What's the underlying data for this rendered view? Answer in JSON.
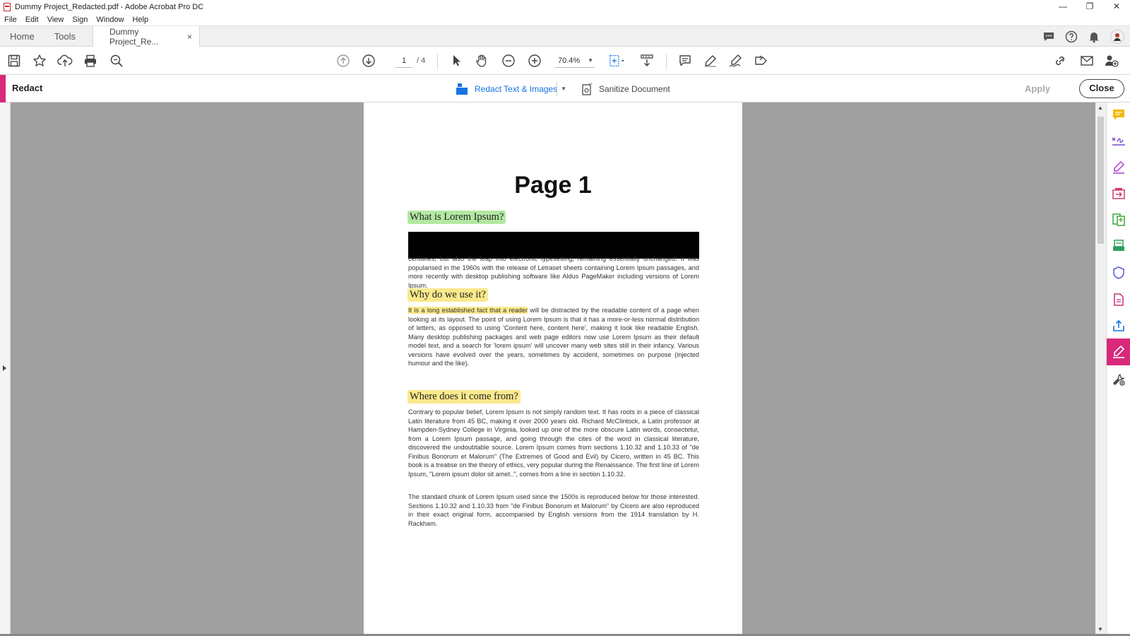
{
  "window": {
    "title": "Dummy Project_Redacted.pdf - Adobe Acrobat Pro DC",
    "controls": [
      "—",
      "❐",
      "✕"
    ]
  },
  "menu": [
    "File",
    "Edit",
    "View",
    "Sign",
    "Window",
    "Help"
  ],
  "tabs": {
    "home": "Home",
    "tools": "Tools",
    "document": "Dummy Project_Re...",
    "close": "×"
  },
  "toolbar": {
    "page_current": "1",
    "page_total": "/ 4",
    "zoom": "70.4%"
  },
  "redact_bar": {
    "title": "Redact",
    "redact_label": "Redact Text & Images",
    "sanitize_label": "Sanitize Document",
    "apply_label": "Apply",
    "close_label": "Close"
  },
  "document": {
    "page_title": "Page 1",
    "heading1": "What is Lorem Ipsum?",
    "para1": "centuries, but also the leap into electronic typesetting, remaining essentially unchanged. It was popularised in the 1960s with the release of Letraset sheets containing Lorem Ipsum passages, and more recently with desktop publishing software like Aldus PageMaker including versions of Lorem Ipsum.",
    "heading2": "Why do we use it?",
    "para2_highlight": "It is a long established fact that a reader",
    "para2_rest": " will be distracted by the readable content of a page when looking at its layout. The point of using Lorem Ipsum is that it has a more-or-less normal distribution of letters, as opposed to using 'Content here, content here', making it look like readable English. Many desktop publishing packages and web page editors now use Lorem Ipsum as their default model text, and a search for 'lorem ipsum' will uncover many web sites still in their infancy. Various versions have evolved over the years, sometimes by accident, sometimes on purpose (injected humour and the like).",
    "heading3": "Where does it come from?",
    "para3": "Contrary to popular belief, Lorem Ipsum is not simply random text. It has roots in a piece of classical Latin literature from 45 BC, making it over 2000 years old. Richard McClintock, a Latin professor at Hampden-Sydney College in Virginia, looked up one of the more obscure Latin words, consectetur, from a Lorem Ipsum passage, and going through the cites of the word in classical literature, discovered the undoubtable source. Lorem Ipsum comes from sections 1.10.32 and 1.10.33 of \"de Finibus Bonorum et Malorum\" (The Extremes of Good and Evil) by Cicero, written in 45 BC. This book is a treatise on the theory of ethics, very popular during the Renaissance. The first line of Lorem Ipsum, \"Lorem ipsum dolor sit amet..\", comes from a line in section 1.10.32.",
    "para4": "The standard chunk of Lorem Ipsum used since the 1500s is reproduced below for those interested. Sections 1.10.32 and 1.10.33 from \"de Finibus Bonorum et Malorum\" by Cicero are also reproduced in their exact original form, accompanied by English versions from the 1914 translation by H. Rackham."
  },
  "icons": {
    "toolbar": [
      "save-icon",
      "star-icon",
      "upload-icon",
      "print-icon",
      "search-zoom-icon",
      "page-up-icon",
      "page-down-icon",
      "select-arrow-icon",
      "hand-icon",
      "zoom-out-icon",
      "zoom-in-icon",
      "fit-page-icon",
      "scroll-mode-icon",
      "comment-icon",
      "highlight-pen-icon",
      "sign-icon",
      "share-icon",
      "link-icon",
      "mail-icon",
      "add-user-icon"
    ],
    "right_panel": [
      "comment-icon",
      "fill-sign-icon",
      "edit-pdf-icon",
      "export-pdf-icon",
      "organize-pages-icon",
      "scan-icon",
      "protect-icon",
      "create-pdf-icon",
      "share-icon",
      "redact-icon",
      "more-tools-icon"
    ]
  },
  "colors": {
    "accent": "#d8297b",
    "link_blue": "#1473e6",
    "highlight_green": "#b3e8a1",
    "highlight_yellow": "#fbe98c",
    "viewer_bg": "#a0a0a0"
  }
}
